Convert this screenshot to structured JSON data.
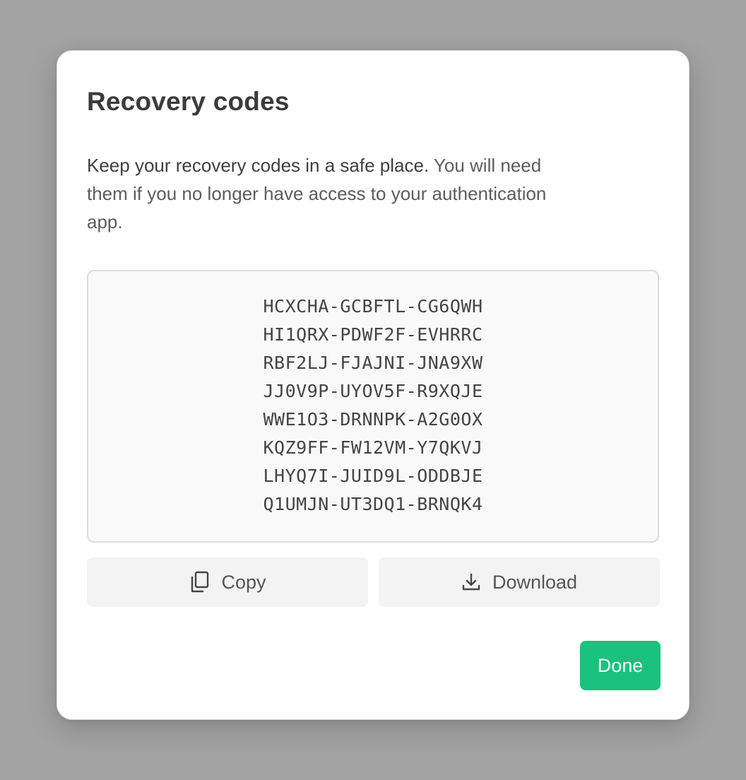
{
  "dialog": {
    "title": "Recovery codes",
    "description_strong": "Keep your recovery codes in a safe place.",
    "description_rest": " You will need them if you no longer have access to your authentication app.",
    "codes": [
      "HCXCHA-GCBFTL-CG6QWH",
      "HI1QRX-PDWF2F-EVHRRC",
      "RBF2LJ-FJAJNI-JNA9XW",
      "JJ0V9P-UYOV5F-R9XQJE",
      "WWE1O3-DRNNPK-A2G0OX",
      "KQZ9FF-FW12VM-Y7QKVJ",
      "LHYQ7I-JUID9L-ODDBJE",
      "Q1UMJN-UT3DQ1-BRNQK4"
    ],
    "copy_label": "Copy",
    "copy_icon": "copy-icon",
    "download_label": "Download",
    "download_icon": "download-icon",
    "done_label": "Done"
  },
  "colors": {
    "backdrop": "#a3a3a3",
    "accent": "#19c37d",
    "panel": "#ffffff",
    "codes_background": "#f9f9f9"
  }
}
